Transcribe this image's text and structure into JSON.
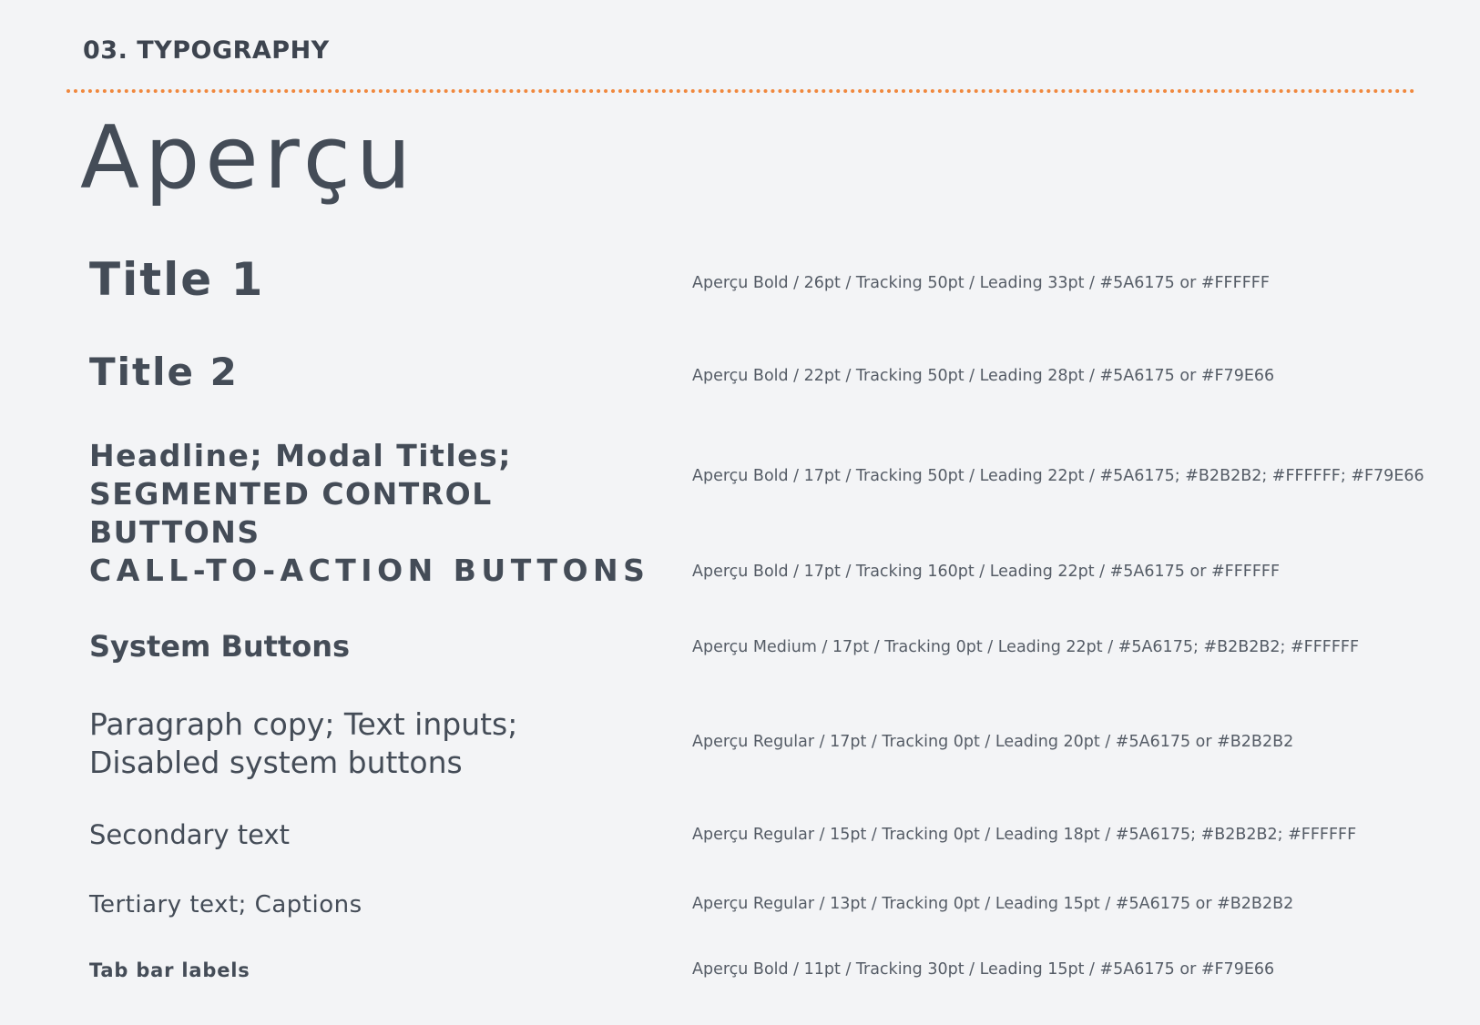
{
  "section_heading": "03. TYPOGRAPHY",
  "font_name": "Aperçu",
  "colors": {
    "accent_divider": "#F0883E",
    "text_primary": "#444C57",
    "background": "#F3F4F6"
  },
  "styles": [
    {
      "sample_lines": [
        "Title 1"
      ],
      "spec": "Aperçu Bold / 26pt / Tracking 50pt / Leading 33pt / #5A6175  or #FFFFFF"
    },
    {
      "sample_lines": [
        "Title 2"
      ],
      "spec": "Aperçu Bold / 22pt / Tracking 50pt / Leading 28pt / #5A6175  or #F79E66"
    },
    {
      "sample_lines": [
        "Headline; Modal Titles;",
        "SEGMENTED CONTROL BUTTONS"
      ],
      "spec": "Aperçu Bold / 17pt / Tracking 50pt / Leading 22pt / #5A6175;  #B2B2B2; #FFFFFF; #F79E66"
    },
    {
      "sample_lines": [
        "CALL-TO-ACTION BUTTONS"
      ],
      "spec": "Aperçu Bold / 17pt / Tracking  160pt / Leading 22pt / #5A6175 or #FFFFFF"
    },
    {
      "sample_lines": [
        "System Buttons"
      ],
      "spec": "Aperçu Medium  / 17pt / Tracking 0pt / Leading 22pt / #5A6175;  #B2B2B2;  #FFFFFF"
    },
    {
      "sample_lines": [
        "Paragraph copy; Text inputs;",
        "Disabled system buttons"
      ],
      "spec": "Aperçu Regular  / 17pt / Tracking 0pt / Leading 20pt / #5A6175 or #B2B2B2"
    },
    {
      "sample_lines": [
        "Secondary text"
      ],
      "spec": "Aperçu Regular  / 15pt / Tracking 0pt / Leading 18pt / #5A6175; #B2B2B2; #FFFFFF"
    },
    {
      "sample_lines": [
        "Tertiary text; Captions"
      ],
      "spec": "Aperçu Regular  / 13pt / Tracking 0pt / Leading 15pt / #5A6175 or #B2B2B2"
    },
    {
      "sample_lines": [
        "Tab bar labels"
      ],
      "spec": "Aperçu Bold  / 11pt / Tracking 30pt / Leading 15pt / #5A6175 or #F79E66"
    }
  ]
}
